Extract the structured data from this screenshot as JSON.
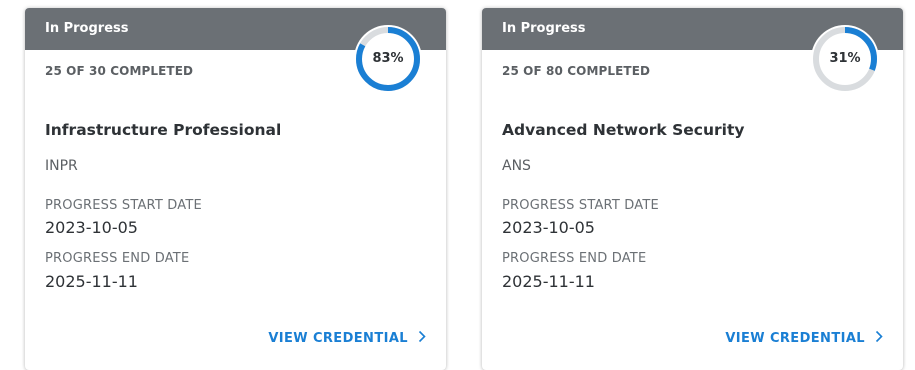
{
  "accent": "#1a7fd4",
  "header_color": "#6b7075",
  "donut_track_color": "#d9dcdf",
  "cards": [
    {
      "status": "In Progress",
      "completed_text": "25 OF 30 COMPLETED",
      "percent": 83,
      "percent_text": "83%",
      "name": "Infrastructure Professional",
      "code": "INPR",
      "start_label": "PROGRESS START DATE",
      "start_date": "2023-10-05",
      "end_label": "PROGRESS END DATE",
      "end_date": "2025-11-11",
      "link_label": "VIEW CREDENTIAL",
      "link_icon": "chevron-right-icon"
    },
    {
      "status": "In Progress",
      "completed_text": "25 OF 80 COMPLETED",
      "percent": 31,
      "percent_text": "31%",
      "name": "Advanced Network Security",
      "code": "ANS",
      "start_label": "PROGRESS START DATE",
      "start_date": "2023-10-05",
      "end_label": "PROGRESS END DATE",
      "end_date": "2025-11-11",
      "link_label": "VIEW CREDENTIAL",
      "link_icon": "chevron-right-icon"
    }
  ]
}
